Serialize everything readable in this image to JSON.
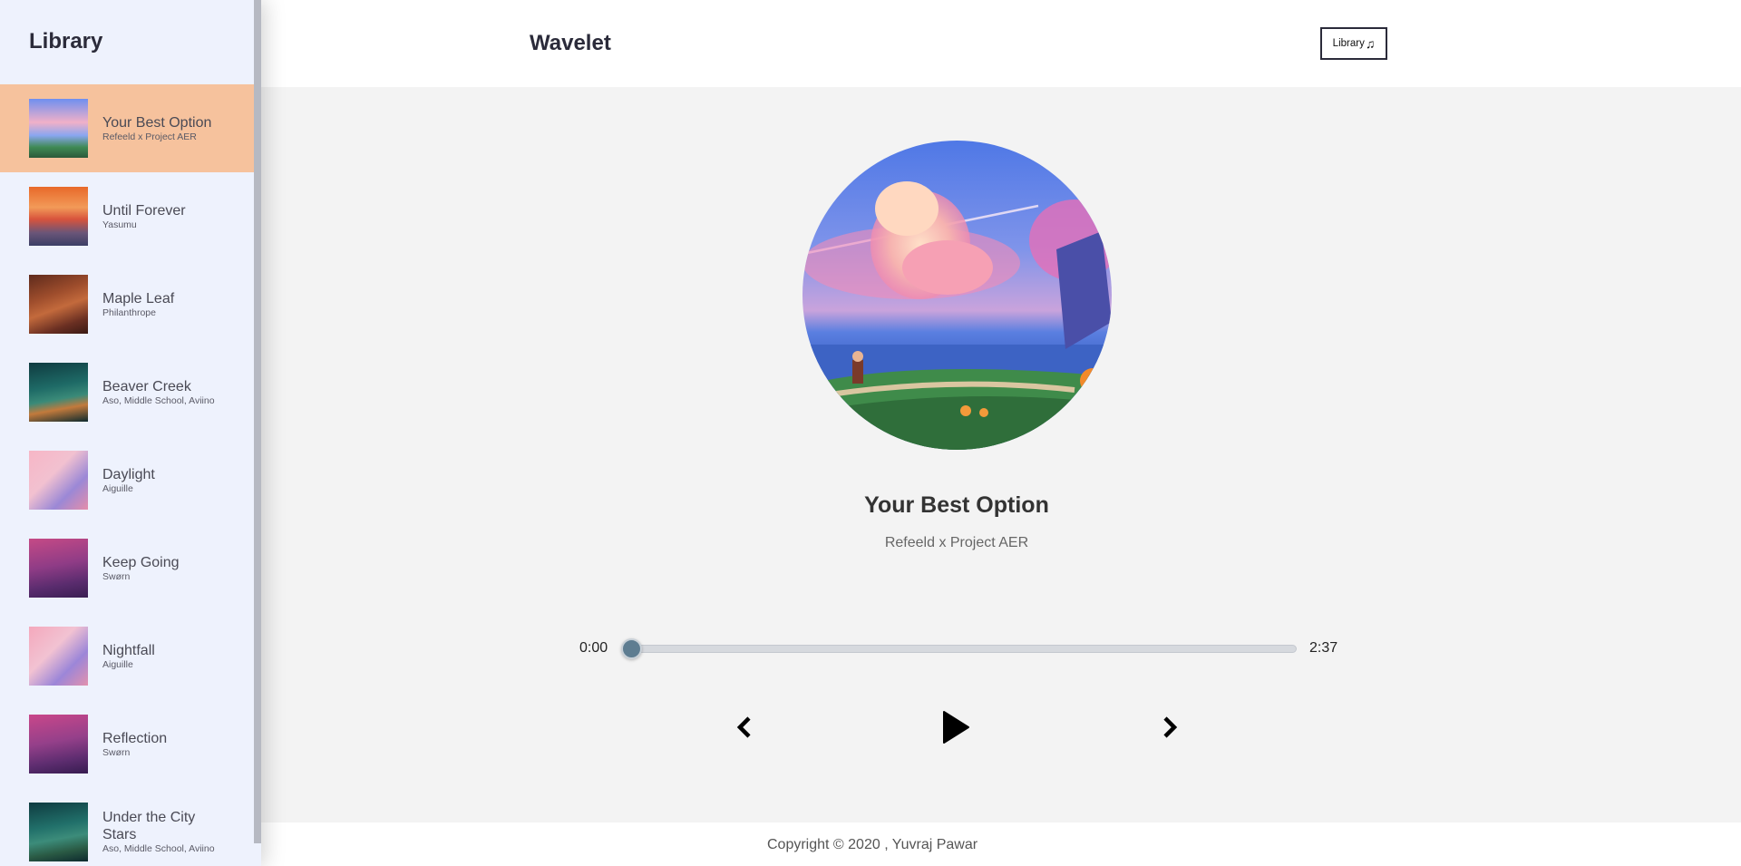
{
  "sidebar": {
    "title": "Library",
    "songs": [
      {
        "name": "Your Best Option",
        "artist": "Refeeld x Project AER",
        "active": true
      },
      {
        "name": "Until Forever",
        "artist": "Yasumu"
      },
      {
        "name": "Maple Leaf",
        "artist": "Philanthrope"
      },
      {
        "name": "Beaver Creek",
        "artist": "Aso, Middle School, Aviino"
      },
      {
        "name": "Daylight",
        "artist": "Aiguille"
      },
      {
        "name": "Keep Going",
        "artist": "Swørn"
      },
      {
        "name": "Nightfall",
        "artist": "Aiguille"
      },
      {
        "name": "Reflection",
        "artist": "Swørn"
      },
      {
        "name": "Under the City Stars",
        "artist": "Aso, Middle School, Aviino"
      }
    ]
  },
  "header": {
    "app_title": "Wavelet",
    "library_button": "Library",
    "library_icon": "music-note-icon"
  },
  "player": {
    "title": "Your Best Option",
    "artist": "Refeeld x Project AER",
    "current_time": "0:00",
    "total_time": "2:37",
    "progress": 0,
    "accent_color": "#5e7d91",
    "active_color": "#f6c29d"
  },
  "footer": {
    "copyright": "Copyright © 2020 , Yuvraj Pawar"
  }
}
